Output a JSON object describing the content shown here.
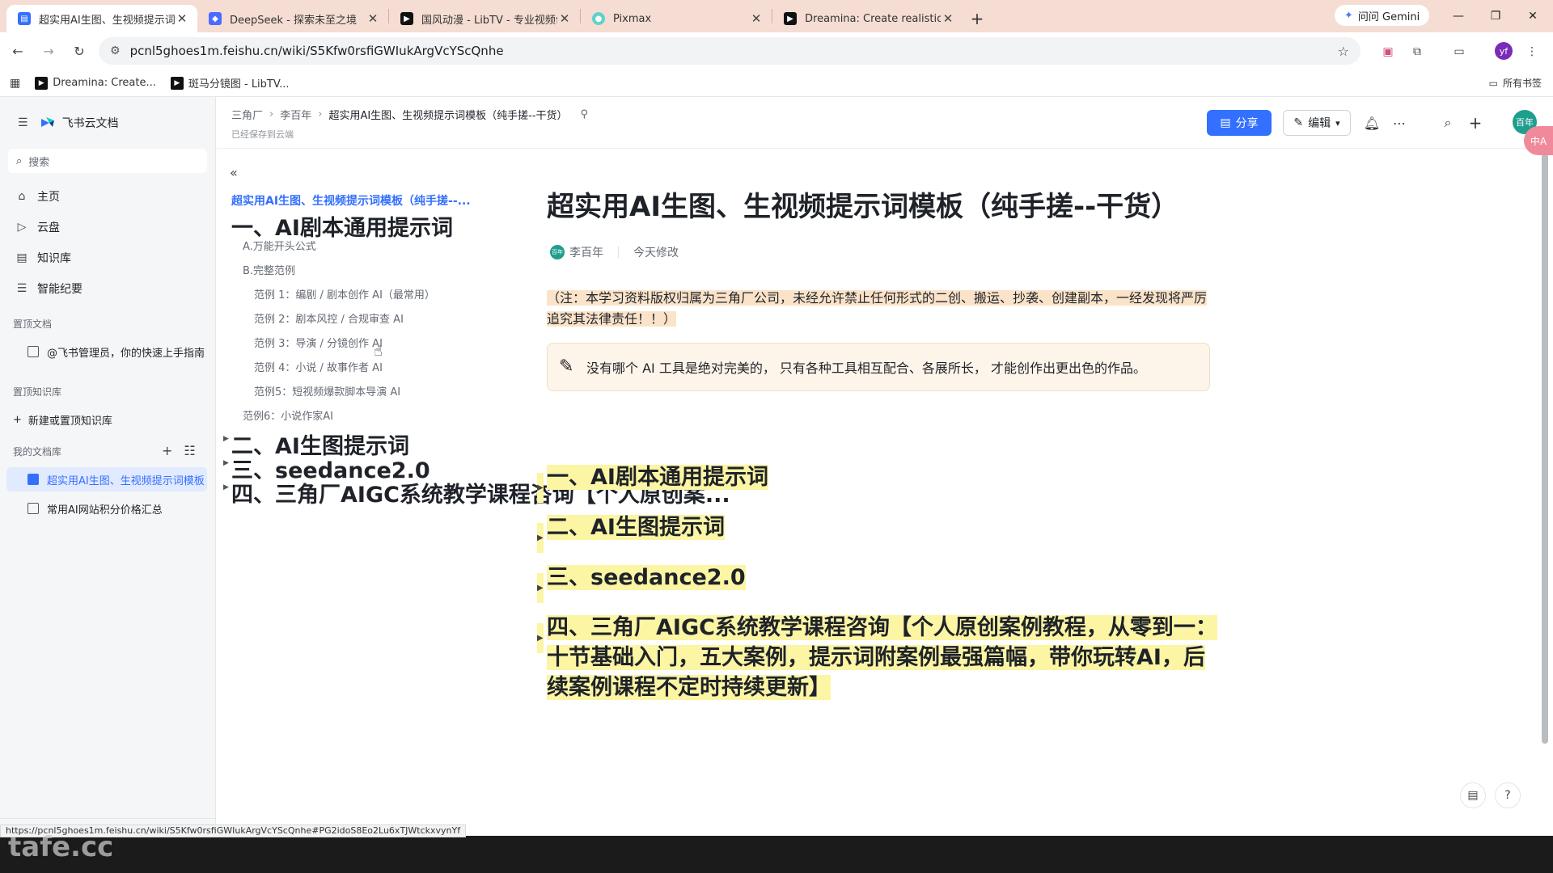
{
  "browser": {
    "tabs": [
      {
        "title": "超实用AI生图、生视频提示词模板",
        "active": true,
        "favicon": "feishu-doc-icon"
      },
      {
        "title": "DeepSeek - 探索未至之境",
        "active": false,
        "favicon": "deepseek-icon"
      },
      {
        "title": "国风动漫 - LibTV - 专业视频创作",
        "active": false,
        "favicon": "libtv-icon"
      },
      {
        "title": "Pixmax",
        "active": false,
        "favicon": "pixmax-icon"
      },
      {
        "title": "Dreamina: Create realistic talking",
        "active": false,
        "favicon": "dreamina-icon"
      }
    ],
    "gemini_label": "问问 Gemini",
    "url": "pcnl5ghoes1m.feishu.cn/wiki/S5Kfw0rsfiGWIukArgVcYScQnhe",
    "profile_initial": "yf",
    "bookmarks": [
      {
        "label": "Dreamina: Create..."
      },
      {
        "label": "斑马分镜图 - LibTV..."
      }
    ],
    "all_bookmarks_label": "所有书签",
    "status_url": "https://pcnl5ghoes1m.feishu.cn/wiki/S5Kfw0rsfiGWIukArgVcYScQnhe#PG2idoS8Eo2Lu6xTJWtckxvynYf"
  },
  "sidebar": {
    "brand": "飞书云文档",
    "search_placeholder": "搜索",
    "nav": [
      {
        "label": "主页",
        "icon": "home-icon"
      },
      {
        "label": "云盘",
        "icon": "cloud-drive-icon"
      },
      {
        "label": "知识库",
        "icon": "knowledge-base-icon"
      },
      {
        "label": "智能纪要",
        "icon": "smart-notes-icon"
      }
    ],
    "pinned_docs_label": "置顶文档",
    "pinned_doc": "@飞书管理员，你的快速上手指南",
    "pinned_kb_label": "置顶知识库",
    "new_kb_label": "新建或置顶知识库",
    "my_library_label": "我的文档库",
    "library_docs": [
      {
        "label": "超实用AI生图、生视频提示词模板",
        "active": true
      },
      {
        "label": "常用AI网站积分价格汇总",
        "active": false
      }
    ]
  },
  "topbar": {
    "breadcrumbs": [
      "三角厂",
      "李百年",
      "超实用AI生图、生视频提示词模板（纯手搓--干货）"
    ],
    "saved_text": "已经保存到云端",
    "share_label": "分享",
    "edit_label": "编辑",
    "user_avatar_text": "百年"
  },
  "toc": {
    "title": "超实用AI生图、生视频提示词模板（纯手搓--...",
    "items": [
      {
        "label": "一、AI剧本通用提示词",
        "level": 1
      },
      {
        "label": "A.万能开头公式",
        "level": 2
      },
      {
        "label": "B.完整范例",
        "level": 2
      },
      {
        "label": "范例 1：编剧 / 剧本创作 AI（最常用）",
        "level": 3
      },
      {
        "label": "范例 2：剧本风控 / 合规审查 AI",
        "level": 3
      },
      {
        "label": "范例 3：导演 / 分镜创作 AI",
        "level": 3
      },
      {
        "label": "范例 4：小说 / 故事作者 AI",
        "level": 3
      },
      {
        "label": "范例5：短视频爆款脚本导演 AI",
        "level": 3
      },
      {
        "label": "范例6：小说作家AI",
        "level": 2
      },
      {
        "label": "二、AI生图提示词",
        "level": 1
      },
      {
        "label": "三、seedance2.0",
        "level": 1
      },
      {
        "label": "四、三角厂AIGC系统教学课程咨询【个人原创案...",
        "level": 1
      }
    ]
  },
  "doc": {
    "title": "超实用AI生图、生视频提示词模板（纯手搓--干货）",
    "author": "李百年",
    "author_avatar_text": "百年",
    "modified": "今天修改",
    "notice": "（注：本学习资料版权归属为三角厂公司，未经允许禁止任何形式的二创、搬运、抄袭、创建副本，一经发现将严厉追究其法律责任！！）",
    "callout": "没有哪个 AI 工具是绝对完美的， 只有各种工具相互配合、各展所长， 才能创作出更出色的作品。",
    "headings": [
      "一、AI剧本通用提示词",
      "二、AI生图提示词",
      "三、seedance2.0",
      "四、三角厂AIGC系统教学课程咨询【个人原创案例教程，从零到一：十节基础入门，五大案例，提示词附案例最强篇幅，带你玩转AI，后续案例课程不定时持续更新】"
    ]
  },
  "translate_badge": "中A",
  "watermark": "tafe.cc",
  "colors": {
    "accent": "#3370ff",
    "heading_highlight": "#fbf5a4",
    "notice_highlight": "#fbe3c9",
    "tab_bar": "#f5ddd3"
  }
}
